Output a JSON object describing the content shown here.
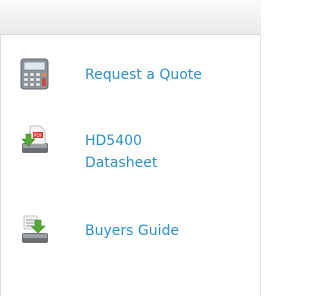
{
  "links": [
    {
      "label": "Request a Quote",
      "icon": "calculator-icon"
    },
    {
      "label": "HD5400\nDatasheet",
      "icon": "pdf-download-icon"
    },
    {
      "label": "Buyers Guide",
      "icon": "document-download-icon"
    }
  ],
  "colors": {
    "link": "#2b8fcc",
    "arrow": "#55aa33"
  }
}
